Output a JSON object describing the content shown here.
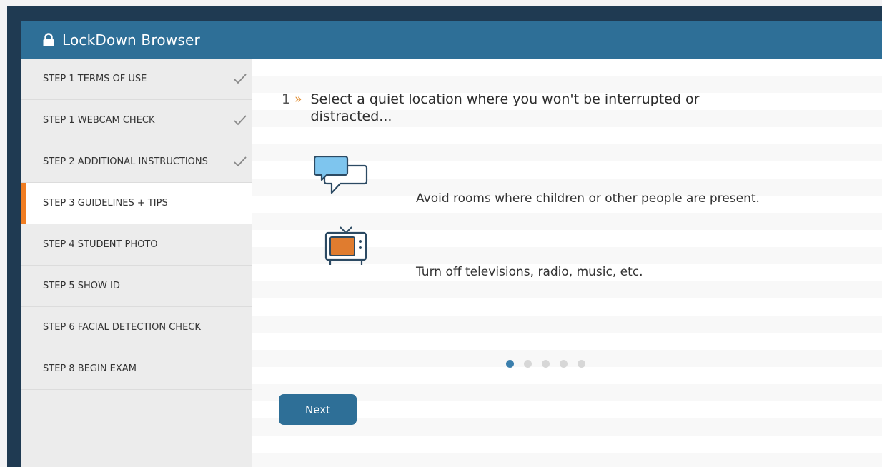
{
  "window": {
    "title": "LockDown Browser",
    "header_color": "#2e6f97",
    "accent_color": "#f07d22"
  },
  "sidebar": {
    "items": [
      {
        "label": "STEP 1 TERMS OF USE",
        "completed": true
      },
      {
        "label": "STEP 1 WEBCAM CHECK",
        "completed": true
      },
      {
        "label": "STEP 2 ADDITIONAL INSTRUCTIONS",
        "completed": true
      },
      {
        "label": "STEP 3 GUIDELINES + TIPS",
        "completed": false,
        "active": true
      },
      {
        "label": "STEP 4 STUDENT PHOTO",
        "completed": false
      },
      {
        "label": "STEP 5 SHOW ID",
        "completed": false
      },
      {
        "label": "STEP 6 FACIAL DETECTION CHECK",
        "completed": false
      },
      {
        "label": "STEP 8 BEGIN EXAM",
        "completed": false
      }
    ]
  },
  "main": {
    "instruction": {
      "number": "1",
      "marker": "»",
      "text": "Select a quiet location where you won't be interrupted or distracted..."
    },
    "tips": [
      {
        "icon": "chat-bubbles-icon",
        "text": "Avoid rooms where children or other people are present."
      },
      {
        "icon": "television-icon",
        "text": "Turn off televisions, radio, music, etc."
      }
    ],
    "pagination": {
      "total": 5,
      "current": 1
    },
    "next_label": "Next"
  }
}
